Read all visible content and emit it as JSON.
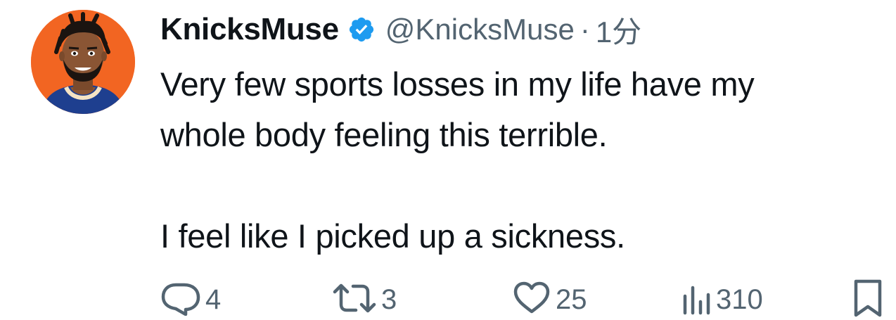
{
  "tweet": {
    "display_name": "KnicksMuse",
    "handle": "@KnicksMuse",
    "separator": "·",
    "time": "1分",
    "text": "Very few sports losses in my life have my\nwhole body feeling this terrible.\n\nI feel like I picked up a sickness.",
    "verified": true,
    "avatar_icon": "cartoon-player-avatar",
    "colors": {
      "avatar_bg": "#f26522",
      "verified": "#1d9bf0",
      "secondary_text": "#536471",
      "primary_text": "#0f1419"
    }
  },
  "actions": {
    "reply_icon": "reply-bubble-icon",
    "reply_count": "4",
    "retweet_icon": "retweet-icon",
    "retweet_count": "3",
    "like_icon": "heart-icon",
    "like_count": "25",
    "views_icon": "views-bar-icon",
    "views_count": "310",
    "bookmark_icon": "bookmark-icon"
  }
}
